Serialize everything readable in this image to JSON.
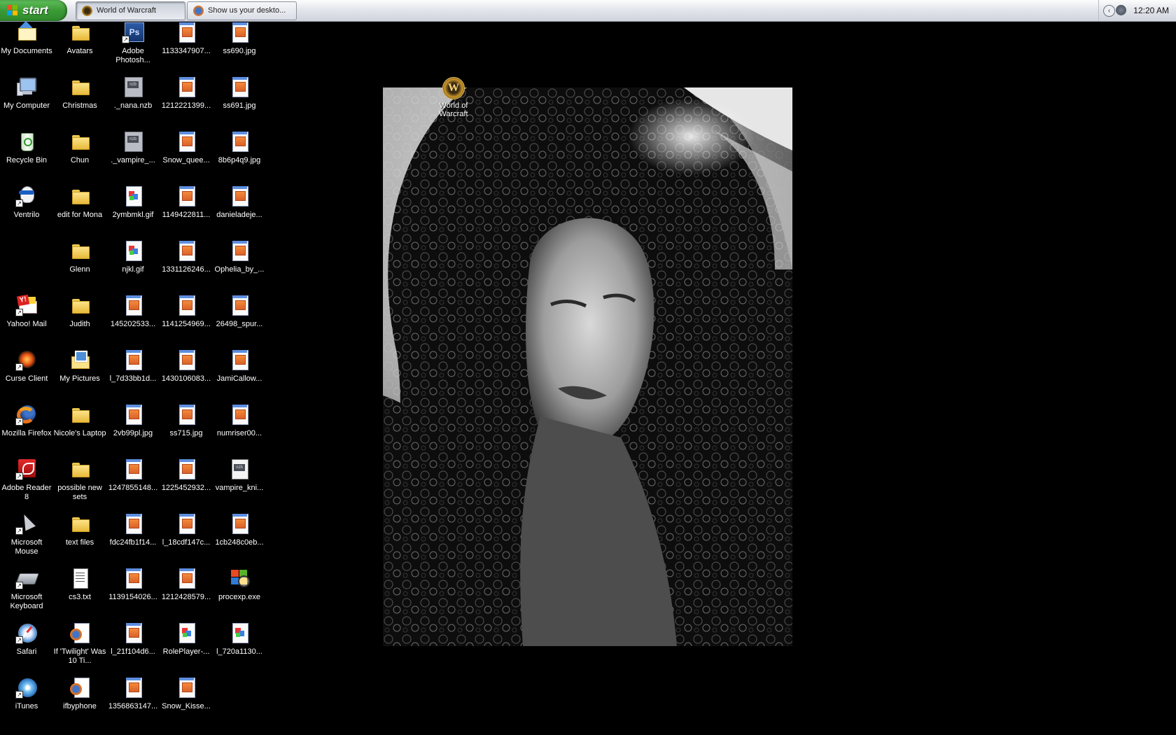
{
  "taskbar": {
    "start_label": "start",
    "tasks": [
      {
        "label": "World of Warcraft",
        "icon": "wow-icon"
      },
      {
        "label": "Show us your deskto...",
        "icon": "firefox-icon"
      }
    ],
    "clock": "12:20 AM",
    "tray_chevron": "‹"
  },
  "desktop": {
    "columns": [
      [
        {
          "label": "My Documents",
          "icon": "my-documents-icon"
        },
        {
          "label": "My Computer",
          "icon": "my-computer-icon"
        },
        {
          "label": "Recycle Bin",
          "icon": "recycle-bin-icon"
        },
        {
          "label": "Ventrilo",
          "icon": "ventrilo-icon"
        },
        {
          "label": "",
          "icon": "empty"
        },
        {
          "label": "Yahoo! Mail",
          "icon": "yahoo-mail-icon"
        },
        {
          "label": "Curse Client",
          "icon": "curse-client-icon"
        },
        {
          "label": "Mozilla Firefox",
          "icon": "firefox-icon"
        },
        {
          "label": "Adobe Reader 8",
          "icon": "adobe-reader-icon"
        },
        {
          "label": "Microsoft Mouse",
          "icon": "microsoft-mouse-icon"
        },
        {
          "label": "Microsoft Keyboard",
          "icon": "microsoft-keyboard-icon"
        },
        {
          "label": "Safari",
          "icon": "safari-icon"
        },
        {
          "label": "iTunes",
          "icon": "itunes-icon"
        }
      ],
      [
        {
          "label": "Avatars",
          "icon": "folder-icon"
        },
        {
          "label": "Christmas",
          "icon": "folder-icon"
        },
        {
          "label": "Chun",
          "icon": "folder-icon"
        },
        {
          "label": "edit for Mona",
          "icon": "folder-icon"
        },
        {
          "label": "Glenn",
          "icon": "folder-icon"
        },
        {
          "label": "Judith",
          "icon": "folder-icon"
        },
        {
          "label": "My Pictures",
          "icon": "my-pictures-icon"
        },
        {
          "label": "Nicole's Laptop",
          "icon": "folder-icon"
        },
        {
          "label": "possible new sets",
          "icon": "folder-icon"
        },
        {
          "label": "text files",
          "icon": "folder-icon"
        },
        {
          "label": "cs3.txt",
          "icon": "text-file-icon"
        },
        {
          "label": "If 'Twilight' Was 10 Ti...",
          "icon": "firefox-document-icon"
        },
        {
          "label": "ifbyphone",
          "icon": "firefox-document-icon"
        }
      ],
      [
        {
          "label": "Adobe Photosh...",
          "icon": "photoshop-icon"
        },
        {
          "label": "._nana.nzb",
          "icon": "nzb-file-icon"
        },
        {
          "label": "._vampire_...",
          "icon": "nzb-file-icon"
        },
        {
          "label": "2ymbmkl.gif",
          "icon": "gif-file-icon"
        },
        {
          "label": "njkl.gif",
          "icon": "gif-file-icon"
        },
        {
          "label": "145202533...",
          "icon": "jpg-file-icon"
        },
        {
          "label": "l_7d33bb1d...",
          "icon": "jpg-file-icon"
        },
        {
          "label": "2vb99pl.jpg",
          "icon": "jpg-file-icon"
        },
        {
          "label": "1247855148...",
          "icon": "jpg-file-icon"
        },
        {
          "label": "fdc24fb1f14...",
          "icon": "jpg-file-icon"
        },
        {
          "label": "1139154026...",
          "icon": "jpg-file-icon"
        },
        {
          "label": "l_21f104d6...",
          "icon": "jpg-file-icon"
        },
        {
          "label": "1356863147...",
          "icon": "jpg-file-icon"
        }
      ],
      [
        {
          "label": "1133347907...",
          "icon": "jpg-file-icon"
        },
        {
          "label": "1212221399...",
          "icon": "jpg-file-icon"
        },
        {
          "label": "Snow_quee...",
          "icon": "jpg-file-icon"
        },
        {
          "label": "1149422811...",
          "icon": "jpg-file-icon"
        },
        {
          "label": "1331126246...",
          "icon": "jpg-file-icon"
        },
        {
          "label": "1141254969...",
          "icon": "jpg-file-icon"
        },
        {
          "label": "1430106083...",
          "icon": "jpg-file-icon"
        },
        {
          "label": "ss715.jpg",
          "icon": "jpg-file-icon"
        },
        {
          "label": "1225452932...",
          "icon": "jpg-file-icon"
        },
        {
          "label": "l_18cdf147c...",
          "icon": "jpg-file-icon"
        },
        {
          "label": "1212428579...",
          "icon": "jpg-file-icon"
        },
        {
          "label": "RolePlayer-...",
          "icon": "gif-file-icon"
        },
        {
          "label": "Snow_Kisse...",
          "icon": "jpg-file-icon"
        }
      ],
      [
        {
          "label": "ss690.jpg",
          "icon": "jpg-file-icon"
        },
        {
          "label": "ss691.jpg",
          "icon": "jpg-file-icon"
        },
        {
          "label": "8b6p4q9.jpg",
          "icon": "jpg-file-icon"
        },
        {
          "label": "danieladeje...",
          "icon": "jpg-file-icon"
        },
        {
          "label": "Ophelia_by_...",
          "icon": "jpg-file-icon"
        },
        {
          "label": "26498_spur...",
          "icon": "jpg-file-icon"
        },
        {
          "label": "JamiCallow...",
          "icon": "jpg-file-icon"
        },
        {
          "label": "numriser00...",
          "icon": "jpg-file-icon"
        },
        {
          "label": "vampire_kni...",
          "icon": "vampire-doc-icon"
        },
        {
          "label": "1cb248c0eb...",
          "icon": "jpg-file-icon"
        },
        {
          "label": "procexp.exe",
          "icon": "process-explorer-icon"
        },
        {
          "label": "l_720a1130...",
          "icon": "gif-file-icon"
        },
        {
          "label": "",
          "icon": "empty"
        }
      ]
    ],
    "wow_shortcut": {
      "label": "World of Warcraft",
      "badge": "W",
      "icon": "world-of-warcraft-icon"
    }
  },
  "colors": {
    "desktop_background": "#000000",
    "start_green": "#3b9a36",
    "taskbar": "#e4e6ec"
  }
}
